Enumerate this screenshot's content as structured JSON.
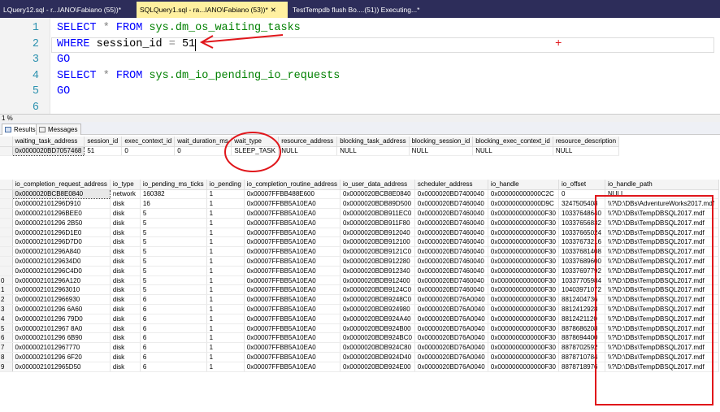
{
  "tabs": [
    {
      "label": "LQuery12.sql - r...IANO\\Fabiano (55))*",
      "active": false
    },
    {
      "label": "SQLQuery1.sql - ra...IANO\\Fabiano (53))*",
      "active": true
    },
    {
      "label": "TestTempdb flush Bo....(51)) Executing...*",
      "active": false
    }
  ],
  "editor": {
    "lines": [
      {
        "num": "1",
        "tokens": [
          {
            "t": "SELECT ",
            "c": "kw"
          },
          {
            "t": "* ",
            "c": "op"
          },
          {
            "t": "FROM ",
            "c": "kw"
          },
          {
            "t": "sys.dm_os_waiting_tasks",
            "c": "fn"
          }
        ]
      },
      {
        "num": "2",
        "tokens": [
          {
            "t": "WHERE ",
            "c": "kw"
          },
          {
            "t": "session_id ",
            "c": ""
          },
          {
            "t": "= ",
            "c": "op"
          },
          {
            "t": "51",
            "c": ""
          }
        ]
      },
      {
        "num": "3",
        "tokens": [
          {
            "t": "GO",
            "c": "kw"
          }
        ]
      },
      {
        "num": "4",
        "tokens": [
          {
            "t": "SELECT ",
            "c": "kw"
          },
          {
            "t": "* ",
            "c": "op"
          },
          {
            "t": "FROM ",
            "c": "kw"
          },
          {
            "t": "sys.dm_io_pending_io_requests",
            "c": "fn"
          }
        ]
      },
      {
        "num": "5",
        "tokens": [
          {
            "t": "GO",
            "c": "kw"
          }
        ]
      },
      {
        "num": "6",
        "tokens": []
      }
    ]
  },
  "zoom": "1 %",
  "result_tabs": [
    {
      "label": "Results",
      "active": true
    },
    {
      "label": "Messages",
      "active": false
    }
  ],
  "grid1": {
    "columns": [
      "waiting_task_address",
      "session_id",
      "exec_context_id",
      "wait_duration_ms",
      "wait_type",
      "resource_address",
      "blocking_task_address",
      "blocking_session_id",
      "blocking_exec_context_id",
      "resource_description"
    ],
    "rows": [
      [
        "0x0000020BD7057468",
        "51",
        "0",
        "0",
        "SLEEP_TASK",
        "NULL",
        "NULL",
        "NULL",
        "NULL",
        "NULL"
      ]
    ]
  },
  "grid2": {
    "columns": [
      "io_completion_request_address",
      "io_type",
      "io_pending_ms_ticks",
      "io_pending",
      "io_completion_routine_address",
      "io_user_data_address",
      "scheduler_address",
      "io_handle",
      "io_offset",
      "io_handle_path"
    ],
    "rows": [
      [
        "",
        "0x0000020BCB8E0840",
        "network",
        "160382",
        "1",
        "0x00007FFBB488E600",
        "0x0000020BCB8E0840",
        "0x0000020BD7400040",
        "0x000000000000C2C",
        "0",
        "NULL"
      ],
      [
        "",
        "0x000002101296D910",
        "disk",
        "16",
        "1",
        "0x00007FFBB5A10EA0",
        "0x0000020BDB89D500",
        "0x0000020BD7460040",
        "0x000000000000D9C",
        "3247505408",
        "\\\\?\\D:\\DBs\\AdventureWorks2017.mdf"
      ],
      [
        "",
        "0x000002101296BEE0",
        "disk",
        "5",
        "1",
        "0x00007FFBB5A10EA0",
        "0x0000020BDB911EC0",
        "0x0000020BD7460040",
        "0x0000000000000F30",
        "10337648640",
        "\\\\?\\D:\\DBs\\TempDBSQL2017.mdf"
      ],
      [
        "",
        "0x000002101296 2B50",
        "disk",
        "5",
        "1",
        "0x00007FFBB5A10EA0",
        "0x0000020BDB911F80",
        "0x0000020BD7460040",
        "0x0000000000000F30",
        "10337656832",
        "\\\\?\\D:\\DBs\\TempDBSQL2017.mdf"
      ],
      [
        "",
        "0x000002101296D1E0",
        "disk",
        "5",
        "1",
        "0x00007FFBB5A10EA0",
        "0x0000020BDB912040",
        "0x0000020BD7460040",
        "0x0000000000000F30",
        "10337665024",
        "\\\\?\\D:\\DBs\\TempDBSQL2017.mdf"
      ],
      [
        "",
        "0x000002101296D7D0",
        "disk",
        "5",
        "1",
        "0x00007FFBB5A10EA0",
        "0x0000020BDB912100",
        "0x0000020BD7460040",
        "0x0000000000000F30",
        "10337673216",
        "\\\\?\\D:\\DBs\\TempDBSQL2017.mdf"
      ],
      [
        "",
        "0x000002101296A840",
        "disk",
        "5",
        "1",
        "0x00007FFBB5A10EA0",
        "0x0000020BDB9121C0",
        "0x0000020BD7460040",
        "0x0000000000000F30",
        "10337681408",
        "\\\\?\\D:\\DBs\\TempDBSQL2017.mdf"
      ],
      [
        "",
        "0x00000210129634D0",
        "disk",
        "5",
        "1",
        "0x00007FFBB5A10EA0",
        "0x0000020BDB912280",
        "0x0000020BD7460040",
        "0x0000000000000F30",
        "10337689600",
        "\\\\?\\D:\\DBs\\TempDBSQL2017.mdf"
      ],
      [
        "",
        "0x000002101296C4D0",
        "disk",
        "5",
        "1",
        "0x00007FFBB5A10EA0",
        "0x0000020BDB912340",
        "0x0000020BD7460040",
        "0x0000000000000F30",
        "10337697792",
        "\\\\?\\D:\\DBs\\TempDBSQL2017.mdf"
      ],
      [
        "0",
        "0x000002101296A120",
        "disk",
        "5",
        "1",
        "0x00007FFBB5A10EA0",
        "0x0000020BDB912400",
        "0x0000020BD7460040",
        "0x0000000000000F30",
        "10337705984",
        "\\\\?\\D:\\DBs\\TempDBSQL2017.mdf"
      ],
      [
        "1",
        "0x0000021012963010",
        "disk",
        "5",
        "1",
        "0x00007FFBB5A10EA0",
        "0x0000020BDB9124C0",
        "0x0000020BD7460040",
        "0x0000000000000F30",
        "10403971072",
        "\\\\?\\D:\\DBs\\TempDBSQL2017.mdf"
      ],
      [
        "2",
        "0x0000021012966930",
        "disk",
        "6",
        "1",
        "0x00007FFBB5A10EA0",
        "0x0000020BDB9248C0",
        "0x0000020BD76A0040",
        "0x0000000000000F30",
        "8812404736",
        "\\\\?\\D:\\DBs\\TempDBSQL2017.mdf"
      ],
      [
        "3",
        "0x000002101296 6A60",
        "disk",
        "6",
        "1",
        "0x00007FFBB5A10EA0",
        "0x0000020BDB924980",
        "0x0000020BD76A0040",
        "0x0000000000000F30",
        "8812412928",
        "\\\\?\\D:\\DBs\\TempDBSQL2017.mdf"
      ],
      [
        "4",
        "0x000002101296 79D0",
        "disk",
        "6",
        "1",
        "0x00007FFBB5A10EA0",
        "0x0000020BDB924A40",
        "0x0000020BD76A0040",
        "0x0000000000000F30",
        "8812421120",
        "\\\\?\\D:\\DBs\\TempDBSQL2017.mdf"
      ],
      [
        "5",
        "0x0000021012967 8A0",
        "disk",
        "6",
        "1",
        "0x00007FFBB5A10EA0",
        "0x0000020BDB924B00",
        "0x0000020BD76A0040",
        "0x0000000000000F30",
        "8878686208",
        "\\\\?\\D:\\DBs\\TempDBSQL2017.mdf"
      ],
      [
        "6",
        "0x000002101296 6B90",
        "disk",
        "6",
        "1",
        "0x00007FFBB5A10EA0",
        "0x0000020BDB924BC0",
        "0x0000020BD76A0040",
        "0x0000000000000F30",
        "8878694400",
        "\\\\?\\D:\\DBs\\TempDBSQL2017.mdf"
      ],
      [
        "7",
        "0x0000021012967770",
        "disk",
        "6",
        "1",
        "0x00007FFBB5A10EA0",
        "0x0000020BDB924C80",
        "0x0000020BD76A0040",
        "0x0000000000000F30",
        "8878702592",
        "\\\\?\\D:\\DBs\\TempDBSQL2017.mdf"
      ],
      [
        "8",
        "0x000002101296 6F20",
        "disk",
        "6",
        "1",
        "0x00007FFBB5A10EA0",
        "0x0000020BDB924D40",
        "0x0000020BD76A0040",
        "0x0000000000000F30",
        "8878710784",
        "\\\\?\\D:\\DBs\\TempDBSQL2017.mdf"
      ],
      [
        "9",
        "0x0000021012965D50",
        "disk",
        "6",
        "1",
        "0x00007FFBB5A10EA0",
        "0x0000020BDB924E00",
        "0x0000020BD76A0040",
        "0x0000000000000F30",
        "8878718976",
        "\\\\?\\D:\\DBs\\TempDBSQL2017.mdf"
      ]
    ]
  },
  "annotation_color": "#e0161b"
}
